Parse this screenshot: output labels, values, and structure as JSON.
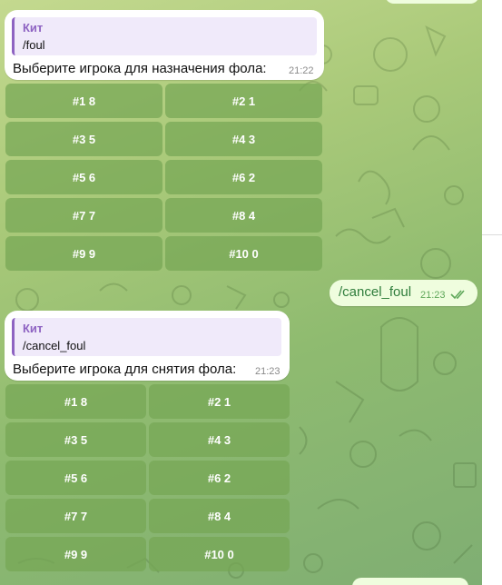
{
  "colors": {
    "background": "#a9c979",
    "incoming_bubble": "#ffffff",
    "outgoing_bubble": "#effdde",
    "reply_accent": "#8e63c2",
    "keyboard_button": "#76a654",
    "outgoing_text": "#2f7d3c",
    "read_ticks": "#5fa85a"
  },
  "messages": [
    {
      "reply_name": "Кит",
      "reply_text": "/foul",
      "text": "Выберите игрока для назначения фола:",
      "time": "21:22"
    },
    {
      "text": "/cancel_foul",
      "time": "21:23",
      "status_icon": "double-check-icon"
    },
    {
      "reply_name": "Кит",
      "reply_text": "/cancel_foul",
      "text": "Выберите игрока для снятия фола:",
      "time": "21:23"
    }
  ],
  "keyboards": [
    {
      "buttons": [
        "#1 8",
        "#2 1",
        "#3 5",
        "#4 3",
        "#5 6",
        "#6 2",
        "#7 7",
        "#8 4",
        "#9 9",
        "#10 0"
      ]
    },
    {
      "buttons": [
        "#1 8",
        "#2 1",
        "#3 5",
        "#4 3",
        "#5 6",
        "#6 2",
        "#7 7",
        "#8 4",
        "#9 9",
        "#10 0"
      ]
    }
  ]
}
